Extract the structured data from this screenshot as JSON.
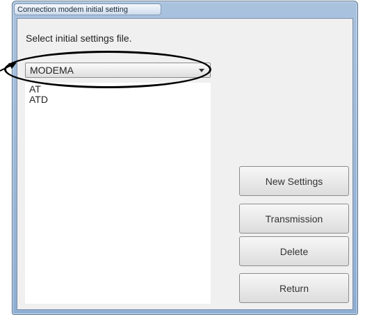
{
  "window": {
    "title": "Connection modem initial setting"
  },
  "prompt": "Select initial settings file.",
  "combo": {
    "selected": "MODEMA"
  },
  "list": {
    "items": [
      "AT",
      "ATD"
    ]
  },
  "buttons": {
    "new_settings": "New Settings",
    "transmission": "Transmission",
    "delete": "Delete",
    "return": "Return"
  }
}
